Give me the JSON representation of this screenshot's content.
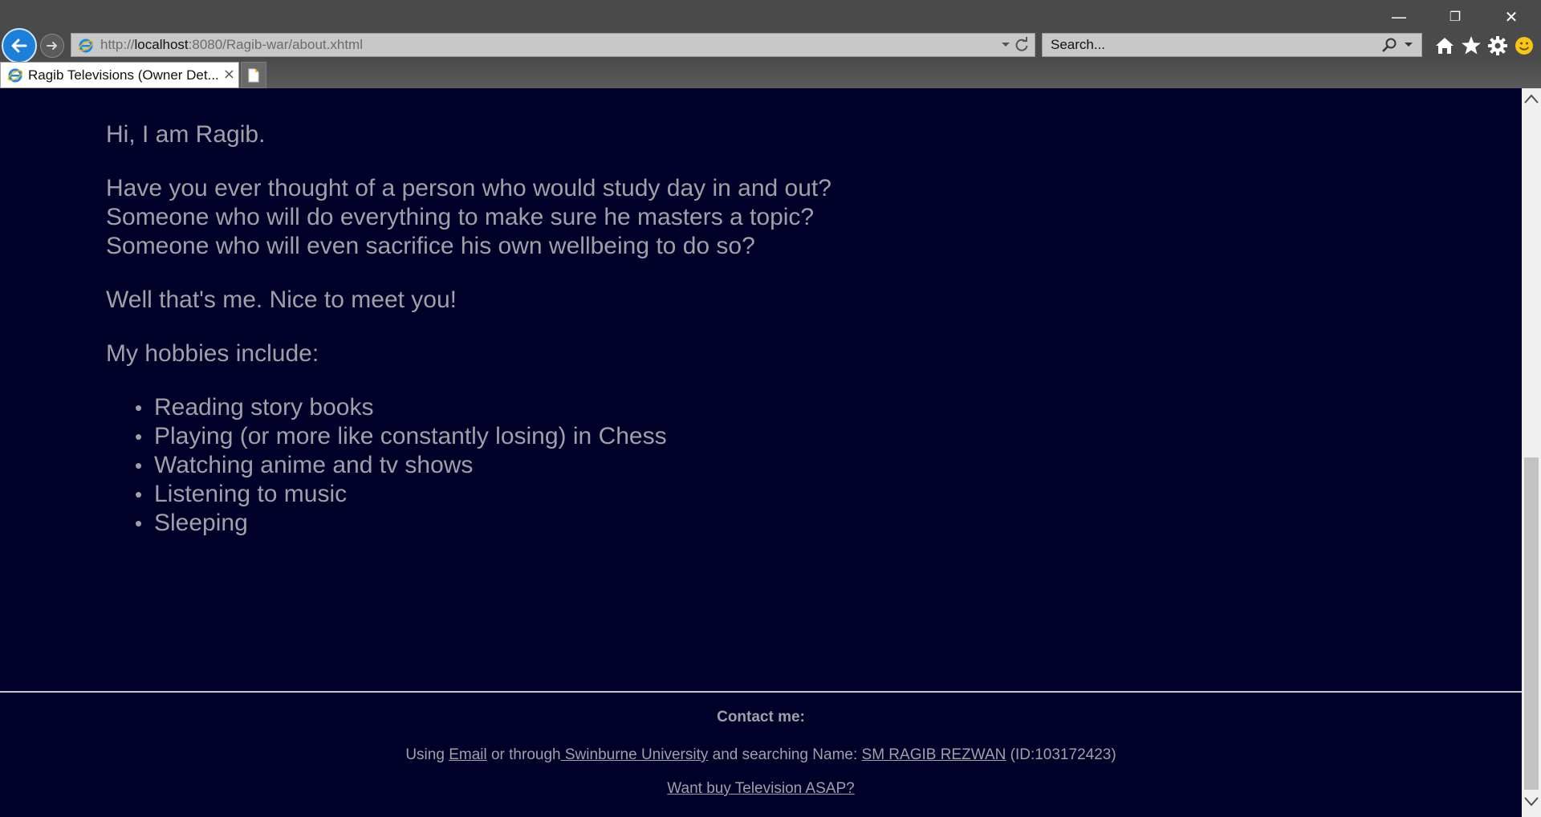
{
  "window": {
    "minimize_glyph": "—",
    "restore_glyph": "❐",
    "close_glyph": "✕"
  },
  "address_bar": {
    "url_prefix": "http://",
    "url_host": "localhost",
    "url_rest": ":8080/Ragib-war/about.xhtml"
  },
  "search": {
    "placeholder": "Search..."
  },
  "tabs": [
    {
      "title": "Ragib Televisions (Owner Det...",
      "close": "×"
    }
  ],
  "icons": {
    "back": "back-arrow-icon",
    "forward": "forward-arrow-icon",
    "refresh": "refresh-icon",
    "search": "search-icon",
    "home": "home-icon",
    "favorites": "star-icon",
    "tools": "gear-icon",
    "feedback": "smiley-icon"
  },
  "colors": {
    "page_background": "#000028",
    "page_text": "#a0a0a8",
    "accent_blue": "#1c7fd9"
  },
  "content": {
    "greeting": "Hi, I am Ragib.",
    "intro_lines": [
      "Have you ever thought of a person who would study day in and out?",
      "Someone who will do everything to make sure he masters a topic?",
      "Someone who will even sacrifice his own wellbeing to do so?"
    ],
    "well_thats_me": "Well that's me. Nice to meet you!",
    "hobbies_heading": "My hobbies include:",
    "hobbies": [
      "Reading story books",
      "Playing (or more like constantly losing) in Chess",
      "Watching anime and tv shows",
      "Listening to music",
      "Sleeping"
    ]
  },
  "footer": {
    "contact_heading": "Contact me:",
    "using_text": "Using ",
    "email_link": "Email",
    "or_through_text": " or through",
    "university_link": " Swinburne University",
    "and_searching_text": " and searching Name: ",
    "name_link": "SM RAGIB REZWAN",
    "id_text": " (ID:103172423)",
    "want_buy_link": "Want buy Television ASAP?"
  }
}
